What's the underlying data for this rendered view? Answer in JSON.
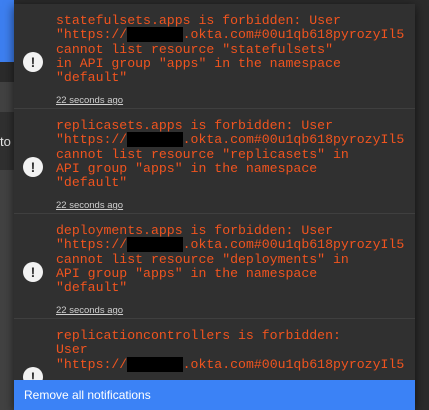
{
  "background": {
    "fragment": "to"
  },
  "notifications": [
    {
      "message_start": "statefulsets.apps is forbidden: User\n\"https://",
      "redacted": "XXXXXXX",
      "message_end": ".okta.com#00u1qb618pyrozyIl5\ncannot list resource \"statefulsets\"\nin API group \"apps\" in the namespace\n\"default\"",
      "time": "22 seconds ago"
    },
    {
      "message_start": "replicasets.apps is forbidden: User\n\"https://",
      "redacted": "XXXXXXX",
      "message_end": ".okta.com#00u1qb618pyrozyIl5\ncannot list resource \"replicasets\" in\nAPI group \"apps\" in the namespace\n\"default\"",
      "time": "22 seconds ago"
    },
    {
      "message_start": "deployments.apps is forbidden: User\n\"https://",
      "redacted": "XXXXXXX",
      "message_end": ".okta.com#00u1qb618pyrozyIl5\ncannot list resource \"deployments\" in\nAPI group \"apps\" in the namespace\n\"default\"",
      "time": "22 seconds ago"
    },
    {
      "message_start": "replicationcontrollers is forbidden:\nUser\n\"https://",
      "redacted": "XXXXXXX",
      "message_end": ".okta.com#00u1qb618pyrozyIl5",
      "time": ""
    }
  ],
  "footer": {
    "remove_all_label": "Remove all notifications"
  },
  "colors": {
    "error_text": "#f0541f",
    "accent": "#3b82f6",
    "panel": "#303030"
  },
  "icons": {
    "notification": "exclamation-circle-icon"
  }
}
